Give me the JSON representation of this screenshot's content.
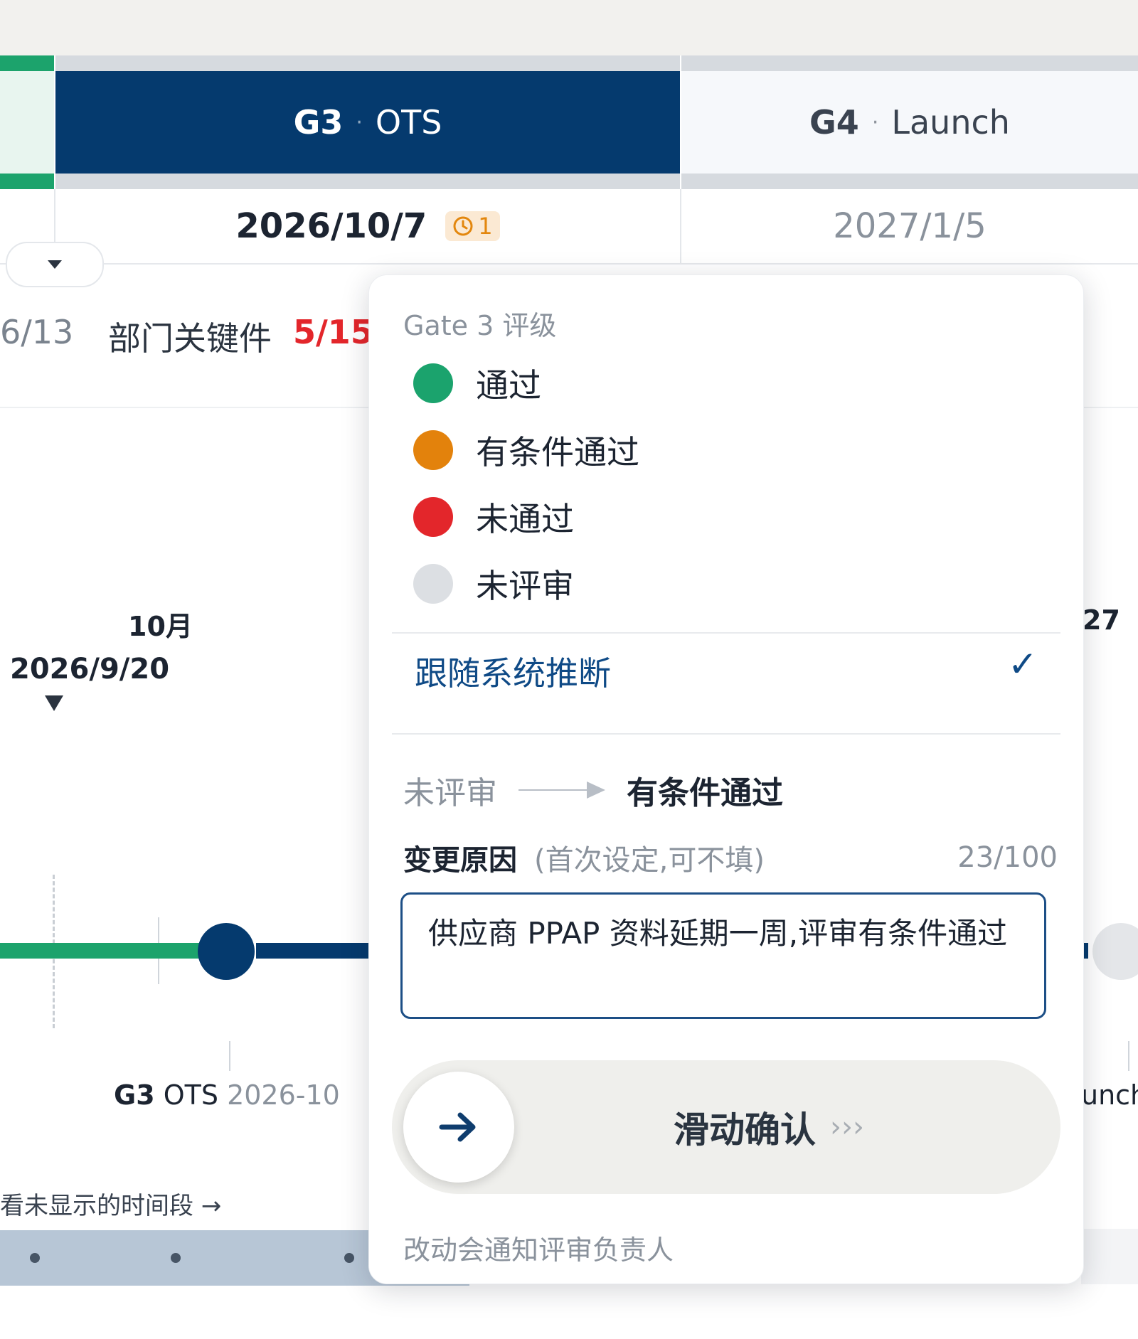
{
  "gates": {
    "g3": {
      "code": "G3",
      "name": "OTS",
      "date": "2026/10/7",
      "badge_count": "1"
    },
    "g4": {
      "code": "G4",
      "name": "Launch",
      "date": "2027/1/5"
    }
  },
  "stats": {
    "left_count": "6/13",
    "dept_label": "部门关键件",
    "dept_count": "5/15"
  },
  "timeline": {
    "month_label": "10月",
    "marker_date": "2026/9/20",
    "right_year_fragment": "27",
    "milestone_g3_code": "G3",
    "milestone_g3_name": "OTS",
    "milestone_g3_date": "2026-10",
    "milestone_right_fragment": "unch",
    "hidden_link": "看未显示的时间段 →"
  },
  "popover": {
    "title": "Gate 3 评级",
    "options": [
      {
        "label": "通过",
        "color": "#1ba36d"
      },
      {
        "label": "有条件通过",
        "color": "#e3820c"
      },
      {
        "label": "未通过",
        "color": "#e3262b"
      },
      {
        "label": "未评审",
        "color": "#dcdfe3"
      }
    ],
    "follow_system": "跟随系统推断",
    "check_mark": "✓",
    "transition_from": "未评审",
    "transition_to": "有条件通过",
    "reason_label": "变更原因",
    "reason_hint": "(首次设定,可不填)",
    "reason_count": "23/100",
    "reason_text": "供应商 PPAP 资料延期一周,评审有条件通过",
    "slide_label": "滑动确认",
    "slide_chevrons": "›››",
    "notify_text": "改动会通知评审负责人"
  },
  "colors": {
    "navy": "#053a6e",
    "green": "#1ca36c",
    "warn": "#e3870e",
    "red": "#e3262b"
  }
}
